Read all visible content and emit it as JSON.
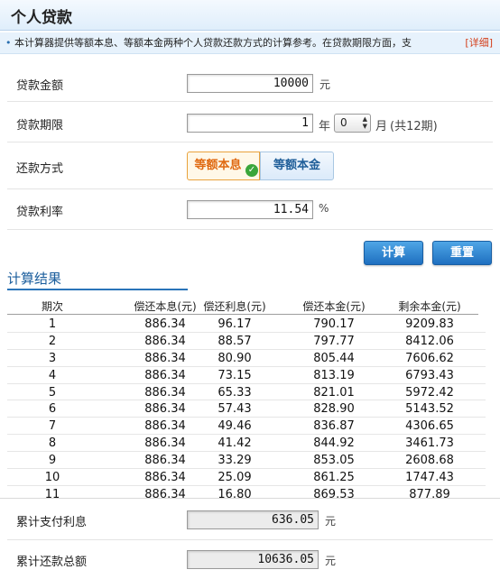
{
  "header": {
    "title": "个人贷款"
  },
  "description": {
    "bullet": "•",
    "text": "本计算器提供等额本息、等额本金两种个人贷款还款方式的计算参考。在贷款期限方面，支",
    "detail_link": "[详细]"
  },
  "form": {
    "amount": {
      "label": "贷款金额",
      "value": "10000",
      "unit": "元"
    },
    "term": {
      "label": "贷款期限",
      "years_value": "1",
      "years_unit": "年",
      "months_value": "0",
      "months_unit": "月",
      "summary": "(共12期)"
    },
    "method": {
      "label": "还款方式",
      "options": [
        "等额本息",
        "等额本金"
      ],
      "selected": "等额本息"
    },
    "rate": {
      "label": "贷款利率",
      "value": "11.54",
      "unit": "%"
    }
  },
  "buttons": {
    "calculate": "计算",
    "reset": "重置"
  },
  "results": {
    "title": "计算结果",
    "columns": [
      "期次",
      "偿还本息(元)",
      "偿还利息(元)",
      "偿还本金(元)",
      "剩余本金(元)"
    ],
    "rows": [
      [
        "1",
        "886.34",
        "96.17",
        "790.17",
        "9209.83"
      ],
      [
        "2",
        "886.34",
        "88.57",
        "797.77",
        "8412.06"
      ],
      [
        "3",
        "886.34",
        "80.90",
        "805.44",
        "7606.62"
      ],
      [
        "4",
        "886.34",
        "73.15",
        "813.19",
        "6793.43"
      ],
      [
        "5",
        "886.34",
        "65.33",
        "821.01",
        "5972.42"
      ],
      [
        "6",
        "886.34",
        "57.43",
        "828.90",
        "5143.52"
      ],
      [
        "7",
        "886.34",
        "49.46",
        "836.87",
        "4306.65"
      ],
      [
        "8",
        "886.34",
        "41.42",
        "844.92",
        "3461.73"
      ],
      [
        "9",
        "886.34",
        "33.29",
        "853.05",
        "2608.68"
      ],
      [
        "10",
        "886.34",
        "25.09",
        "861.25",
        "1747.43"
      ],
      [
        "11",
        "886.34",
        "16.80",
        "869.53",
        "877.89"
      ]
    ]
  },
  "totals": {
    "interest": {
      "label": "累计支付利息",
      "value": "636.05",
      "unit": "元"
    },
    "repayment": {
      "label": "累计还款总额",
      "value": "10636.05",
      "unit": "元"
    }
  },
  "colors": {
    "accent": "#2a74b9",
    "selected_option": "#e06a12",
    "detail_link": "#d43f1a"
  }
}
